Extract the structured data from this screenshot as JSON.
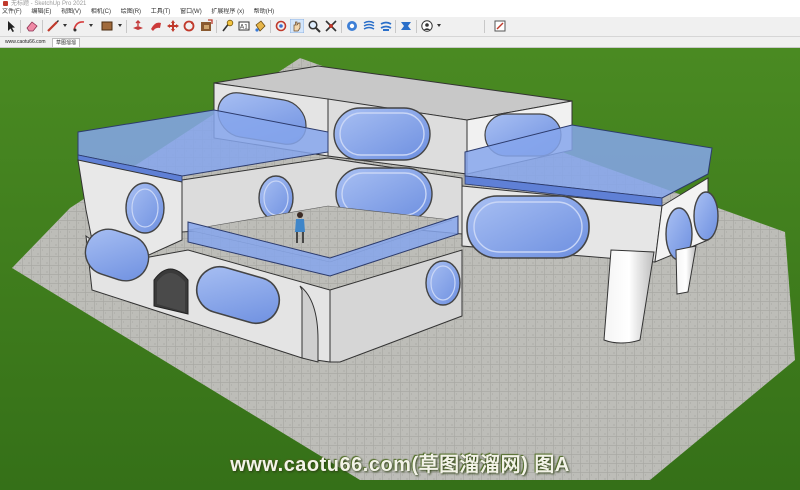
{
  "window": {
    "title": "无标题 - SketchUp Pro 2021"
  },
  "menu": [
    "文件(F)",
    "编辑(E)",
    "视图(V)",
    "相机(C)",
    "绘图(R)",
    "工具(T)",
    "窗口(W)",
    "扩展程序 (x)",
    "帮助(H)"
  ],
  "toolbar": {
    "tools": [
      "select-icon",
      "eraser-icon",
      "line-icon",
      "arc-icon",
      "rectangle-icon",
      "push-pull-icon",
      "follow-me-icon",
      "move-icon",
      "rotate-icon",
      "offset-icon",
      "tape-measure-icon",
      "text-icon",
      "paint-bucket-icon",
      "orbit-icon",
      "pan-icon",
      "zoom-icon",
      "zoom-extents-icon",
      "previous-view-icon",
      "next-view-icon",
      "standard-views-icon",
      "3d-warehouse-icon",
      "extension-warehouse-icon",
      "layout-icon",
      "extension-manager-icon"
    ]
  },
  "scenes": {
    "site_label": "www.caotu66.com",
    "tabs": [
      "草图溜溜"
    ],
    "active": 0
  },
  "viewport": {
    "colors": {
      "grass": "#3f7a1c",
      "pavement": "#b9b9b4",
      "wall": "#e6e6e6",
      "glass": "#7f9ee8",
      "roof": "#c9c9c9"
    },
    "figure": "person-icon"
  },
  "watermark": {
    "text": "www.caotu66.com(草图溜溜网) 图A"
  }
}
